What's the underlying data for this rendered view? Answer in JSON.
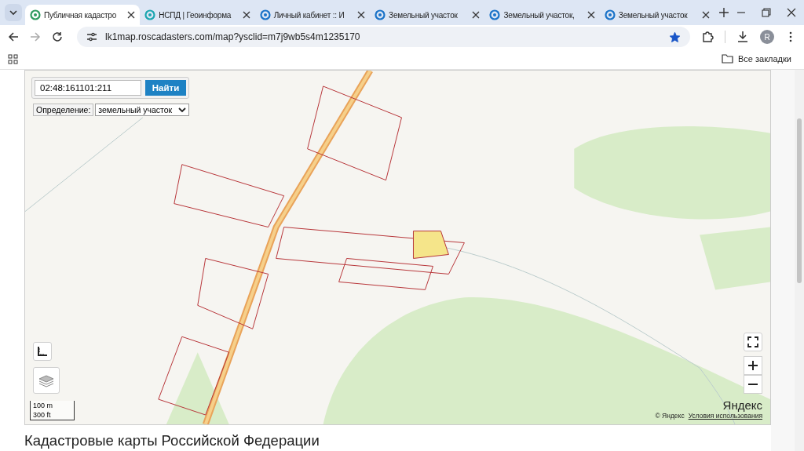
{
  "tabs": [
    {
      "title": "Публичная кадастро",
      "selected": true
    },
    {
      "title": "НСПД | Геоинформа",
      "selected": false
    },
    {
      "title": "Личный кабинет :: И",
      "selected": false
    },
    {
      "title": "Земельный участок",
      "selected": false
    },
    {
      "title": "Земельный участок,",
      "selected": false
    },
    {
      "title": "Земельный участок",
      "selected": false
    }
  ],
  "address_bar": {
    "url": "lk1map.roscadasters.com/map?ysclid=m7j9wb5s4m1235170",
    "bookmarked": true
  },
  "profile": {
    "initial": "R"
  },
  "bookmarks_bar": {
    "all_bookmarks": "Все закладки"
  },
  "map": {
    "search": {
      "value": "02:48:161101:211",
      "button": "Найти"
    },
    "definition": {
      "label": "Определение:",
      "value": "земельный участок"
    },
    "scale": {
      "metric": "100 m",
      "imperial": "300 ft"
    },
    "logo": "Яндекс",
    "copyright": "© Яндекс",
    "terms_link": "Условия использования"
  },
  "heading": "Кадастровые карты Российской Федерации"
}
